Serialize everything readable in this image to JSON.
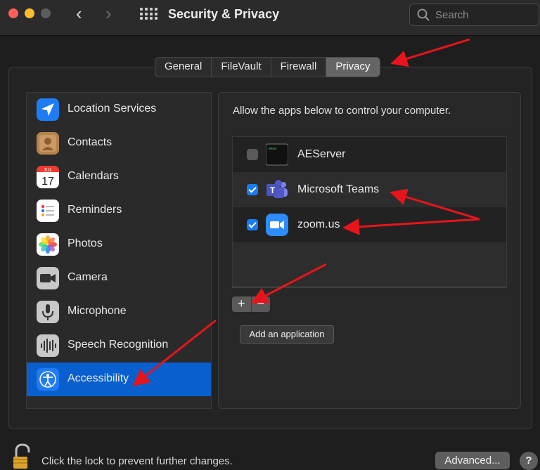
{
  "window": {
    "title": "Security & Privacy",
    "search_placeholder": "Search",
    "back_glyph": "‹",
    "forward_glyph": "›"
  },
  "tabs": [
    {
      "label": "General",
      "active": false
    },
    {
      "label": "FileVault",
      "active": false
    },
    {
      "label": "Firewall",
      "active": false
    },
    {
      "label": "Privacy",
      "active": true
    }
  ],
  "sidebar": {
    "items": [
      {
        "label": "Location Services",
        "icon": "location-arrow-icon",
        "color": "#1f7cf5",
        "selected": false
      },
      {
        "label": "Contacts",
        "icon": "contacts-book-icon",
        "color": "#b5834b",
        "selected": false
      },
      {
        "label": "Calendars",
        "icon": "calendar-icon",
        "color": "#ffffff",
        "selected": false,
        "month": "JUL",
        "day": "17"
      },
      {
        "label": "Reminders",
        "icon": "reminders-list-icon",
        "color": "#ffffff",
        "selected": false
      },
      {
        "label": "Photos",
        "icon": "photos-flower-icon",
        "color": "#ffffff",
        "selected": false
      },
      {
        "label": "Camera",
        "icon": "camera-icon",
        "color": "#c8c8c8",
        "selected": false
      },
      {
        "label": "Microphone",
        "icon": "microphone-icon",
        "color": "#c8c8c8",
        "selected": false
      },
      {
        "label": "Speech Recognition",
        "icon": "waveform-icon",
        "color": "#c8c8c8",
        "selected": false
      },
      {
        "label": "Accessibility",
        "icon": "accessibility-person-icon",
        "color": "#1f7cf5",
        "selected": true
      }
    ]
  },
  "main": {
    "description": "Allow the apps below to control your computer.",
    "apps": [
      {
        "name": "AEServer",
        "checked": false,
        "icon": "terminal-icon",
        "icon_text": "exec"
      },
      {
        "name": "Microsoft Teams",
        "checked": true,
        "icon": "teams-icon",
        "icon_text": "T"
      },
      {
        "name": "zoom.us",
        "checked": true,
        "icon": "zoom-camera-icon",
        "icon_text": ""
      }
    ],
    "plus_label": "+",
    "minus_label": "−",
    "tooltip": "Add an application"
  },
  "footer": {
    "lock_text": "Click the lock to prevent further changes.",
    "advanced_label": "Advanced...",
    "help_label": "?"
  },
  "colors": {
    "accent": "#0a5fcf",
    "annotation_arrow": "#e8141c"
  }
}
